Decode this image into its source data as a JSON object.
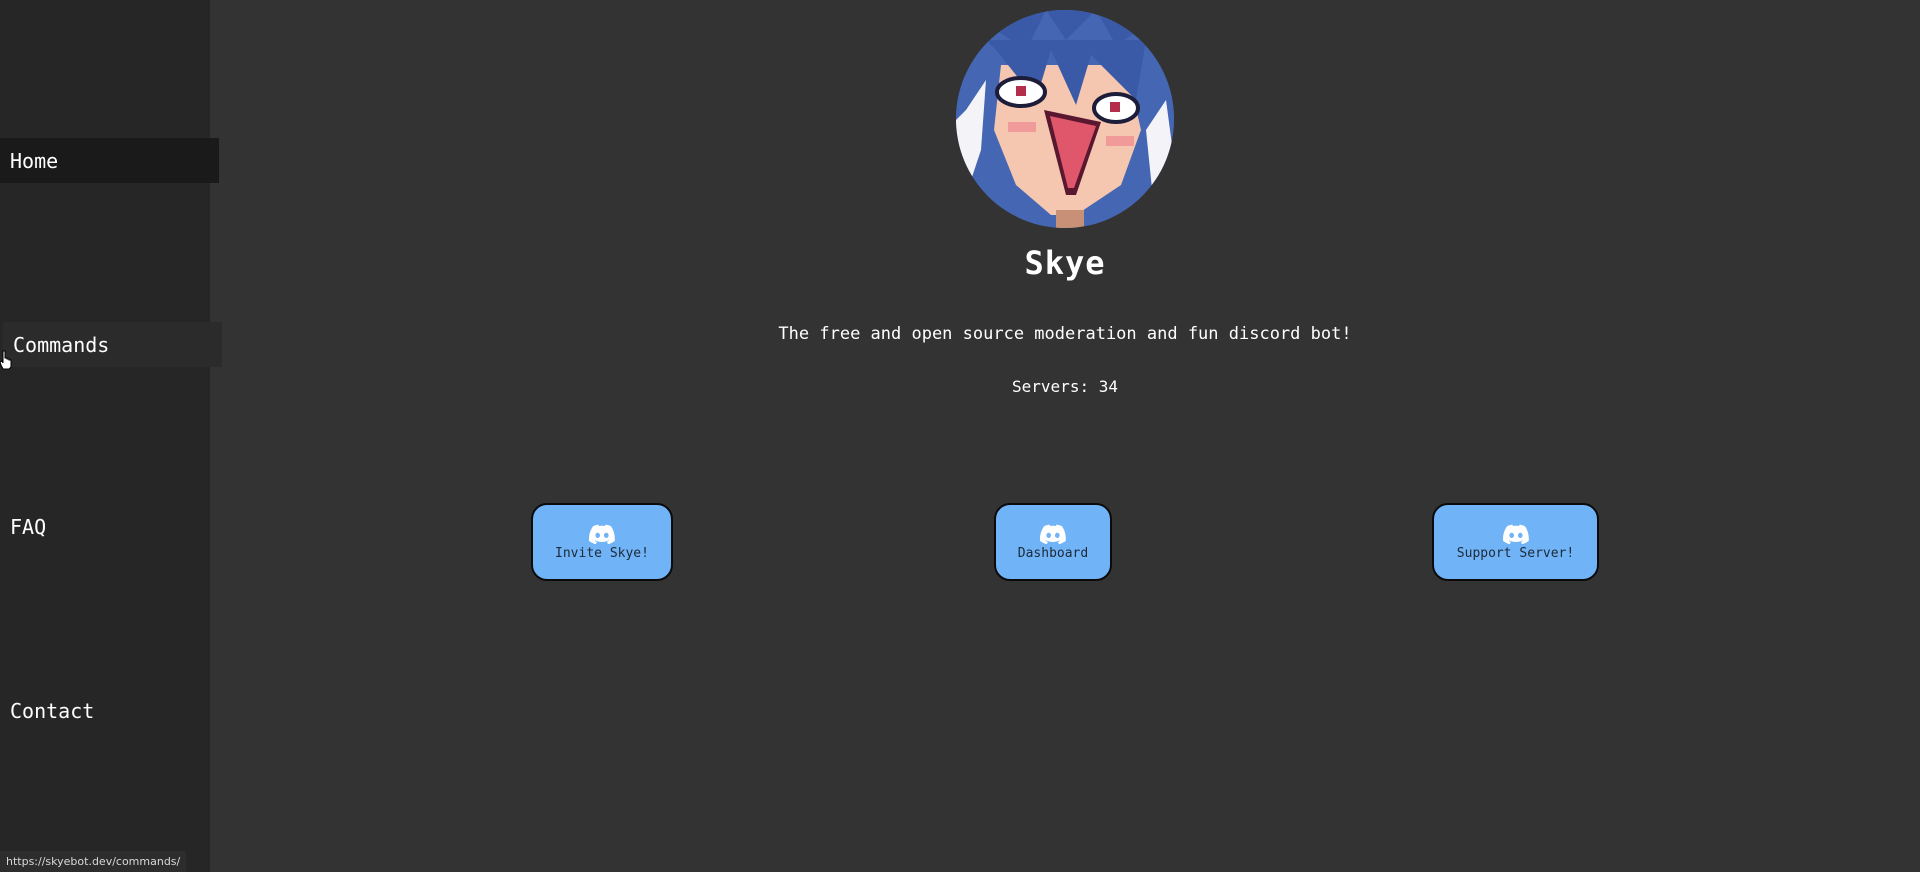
{
  "sidebar": {
    "items": [
      {
        "label": "Home"
      },
      {
        "label": "Commands"
      },
      {
        "label": "FAQ"
      },
      {
        "label": "Contact"
      }
    ]
  },
  "hero": {
    "title": "Skye",
    "tagline": "The free and open source moderation and fun discord bot!",
    "servers_label": "Servers:",
    "servers_count": "34"
  },
  "buttons": [
    {
      "label": "Invite Skye!",
      "icon": "discord-icon"
    },
    {
      "label": "Dashboard",
      "icon": "discord-icon"
    },
    {
      "label": "Support Server!",
      "icon": "discord-icon"
    }
  ],
  "status_bar": {
    "url": "https://skyebot.dev/commands/"
  },
  "colors": {
    "background": "#333333",
    "sidebar": "#262626",
    "button": "#70b3f7",
    "text": "#ffffff"
  }
}
